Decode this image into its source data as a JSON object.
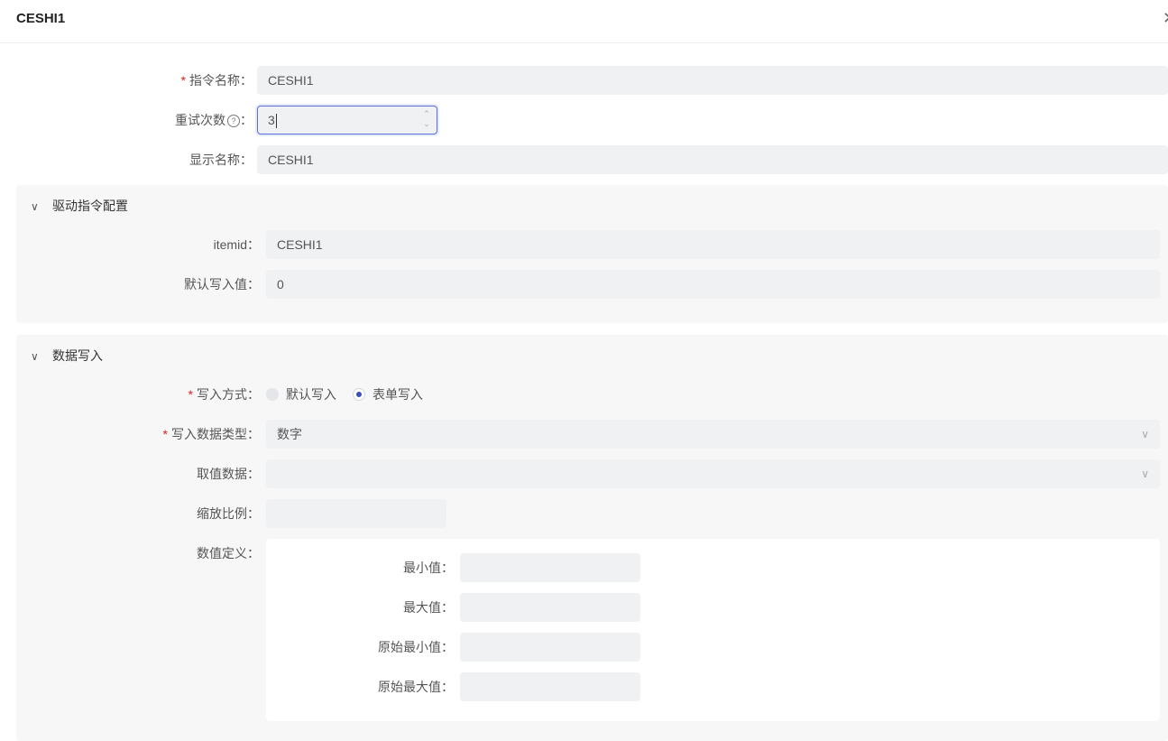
{
  "header": {
    "title": "CESHI1",
    "close_icon": "✕"
  },
  "form": {
    "command_name": {
      "label": "指令名称：",
      "required_mark": "*",
      "value": "CESHI1"
    },
    "retry_count": {
      "label": "重试次数",
      "help_icon": "?",
      "colon": "：",
      "value": "3"
    },
    "display_name": {
      "label": "显示名称：",
      "value": "CESHI1"
    }
  },
  "driver_section": {
    "title": "驱动指令配置",
    "itemid": {
      "label": "itemid：",
      "value": "CESHI1"
    },
    "default_write": {
      "label": "默认写入值：",
      "value": "0"
    }
  },
  "data_write_section": {
    "title": "数据写入",
    "write_mode": {
      "label": "写入方式：",
      "required_mark": "*",
      "options": [
        "默认写入",
        "表单写入"
      ],
      "selected": "表单写入"
    },
    "write_data_type": {
      "label": "写入数据类型：",
      "required_mark": "*",
      "value": "数字"
    },
    "value_data": {
      "label": "取值数据：",
      "value": ""
    },
    "scale_ratio": {
      "label": "缩放比例：",
      "value": ""
    },
    "value_definition": {
      "label": "数值定义：",
      "min": {
        "label": "最小值：",
        "value": ""
      },
      "max": {
        "label": "最大值：",
        "value": ""
      },
      "raw_min": {
        "label": "原始最小值：",
        "value": ""
      },
      "raw_max": {
        "label": "原始最大值：",
        "value": ""
      }
    }
  },
  "colors": {
    "accent": "#3b4fbf",
    "required": "#e02020",
    "input_bg": "#f0f1f3",
    "panel_bg": "#f7f7f8"
  }
}
